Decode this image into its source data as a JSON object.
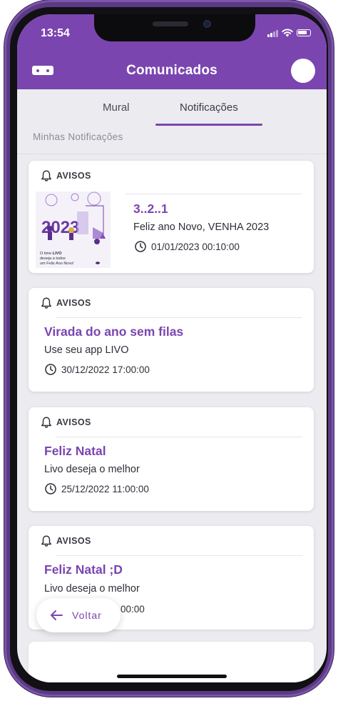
{
  "status_bar": {
    "time": "13:54"
  },
  "header": {
    "title": "Comunicados"
  },
  "tabs": [
    {
      "label": "Mural",
      "active": false
    },
    {
      "label": "Notificações",
      "active": true
    }
  ],
  "section_label": "Minhas Notificações",
  "notifications": [
    {
      "category": "AVISOS",
      "title": "3..2..1",
      "text": "Feliz ano Novo, VENHA 2023",
      "date": "01/01/2023 00:10:00",
      "image": {
        "year": "2023",
        "caption_line1": "O time",
        "caption_brand": "LIVO",
        "caption_line2": "deseja a todos",
        "caption_line3": "um Feliz Ano Novo!"
      }
    },
    {
      "category": "AVISOS",
      "title": "Virada do ano sem filas",
      "text": "Use seu app LIVO",
      "date": "30/12/2022 17:00:00"
    },
    {
      "category": "AVISOS",
      "title": "Feliz Natal",
      "text": "Livo deseja o melhor",
      "date": "25/12/2022 11:00:00"
    },
    {
      "category": "AVISOS",
      "title": "Feliz Natal ;D",
      "text": "Livo deseja o melhor",
      "date": "00:00"
    }
  ],
  "back_button": {
    "label": "Voltar"
  },
  "colors": {
    "brand_purple": "#7b45b0",
    "background": "#ececf0",
    "card": "#ffffff"
  }
}
